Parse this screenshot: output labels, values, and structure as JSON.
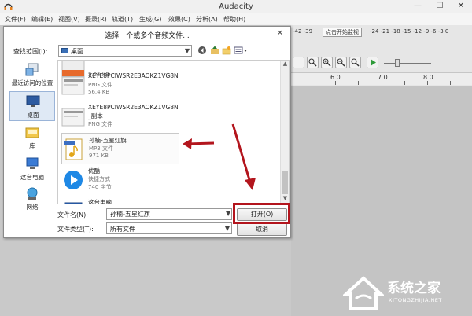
{
  "app": {
    "title": "Audacity",
    "menu": [
      "文件(F)",
      "编辑(E)",
      "视图(V)",
      "摄录(R)",
      "轨道(T)",
      "生成(G)",
      "效果(C)",
      "分析(A)",
      "帮助(H)"
    ],
    "meter_left": "-42 -39",
    "meter_button": "点击开始监视",
    "meter_right": "-24 -21 -18 -15 -12 -9 -6 -3 0",
    "ruler_labels": [
      "6.0",
      "7.0",
      "8.0"
    ],
    "window_controls": {
      "minimize": "—",
      "maximize": "☐",
      "close": "✕"
    }
  },
  "dialog": {
    "title": "选择一个或多个音频文件...",
    "close": "✕",
    "look_in_label": "查找范围(I):",
    "look_in_value": "桌面",
    "places": [
      {
        "label": "最近访问的位置",
        "icon": "recent-places-icon"
      },
      {
        "label": "桌面",
        "icon": "desktop-icon",
        "selected": true
      },
      {
        "label": "库",
        "icon": "library-icon"
      },
      {
        "label": "这台电脑",
        "icon": "computer-icon"
      },
      {
        "label": "网络",
        "icon": "network-icon"
      }
    ],
    "files": [
      {
        "name": "",
        "type": "",
        "size": "2.25 KB",
        "icon": "png-thumb-icon"
      },
      {
        "name": "XEYE8PCIWSR2E3AOKZ1VG8N",
        "type": "PNG 文件",
        "size": "56.4 KB",
        "icon": "png-thumb-icon"
      },
      {
        "name": "XEYE8PCIWSR2E3AOKZ1VG8N",
        "name2": "_副本",
        "type": "PNG 文件",
        "size": "",
        "icon": "png-thumb-icon"
      },
      {
        "name": "孙楠-五星红旗",
        "type": "MP3 文件",
        "size": "971 KB",
        "icon": "mp3-file-icon",
        "highlight": true
      },
      {
        "name": "优酷",
        "type": "快捷方式",
        "size": "740 字节",
        "icon": "youku-icon"
      },
      {
        "name": "这台电脑",
        "type": "快捷方式",
        "size": "",
        "icon": "computer-shortcut-icon"
      }
    ],
    "filename_label": "文件名(N):",
    "filename_value": "孙楠-五星红旗",
    "filetype_label": "文件类型(T):",
    "filetype_value": "所有文件",
    "open_button": "打开(O)",
    "cancel_button": "取消"
  },
  "watermark": {
    "text": "系统之家",
    "sub": "XITONGZHIJIA.NET"
  },
  "colors": {
    "annotation_red": "#b3151d",
    "youku_blue": "#1e88e5"
  }
}
